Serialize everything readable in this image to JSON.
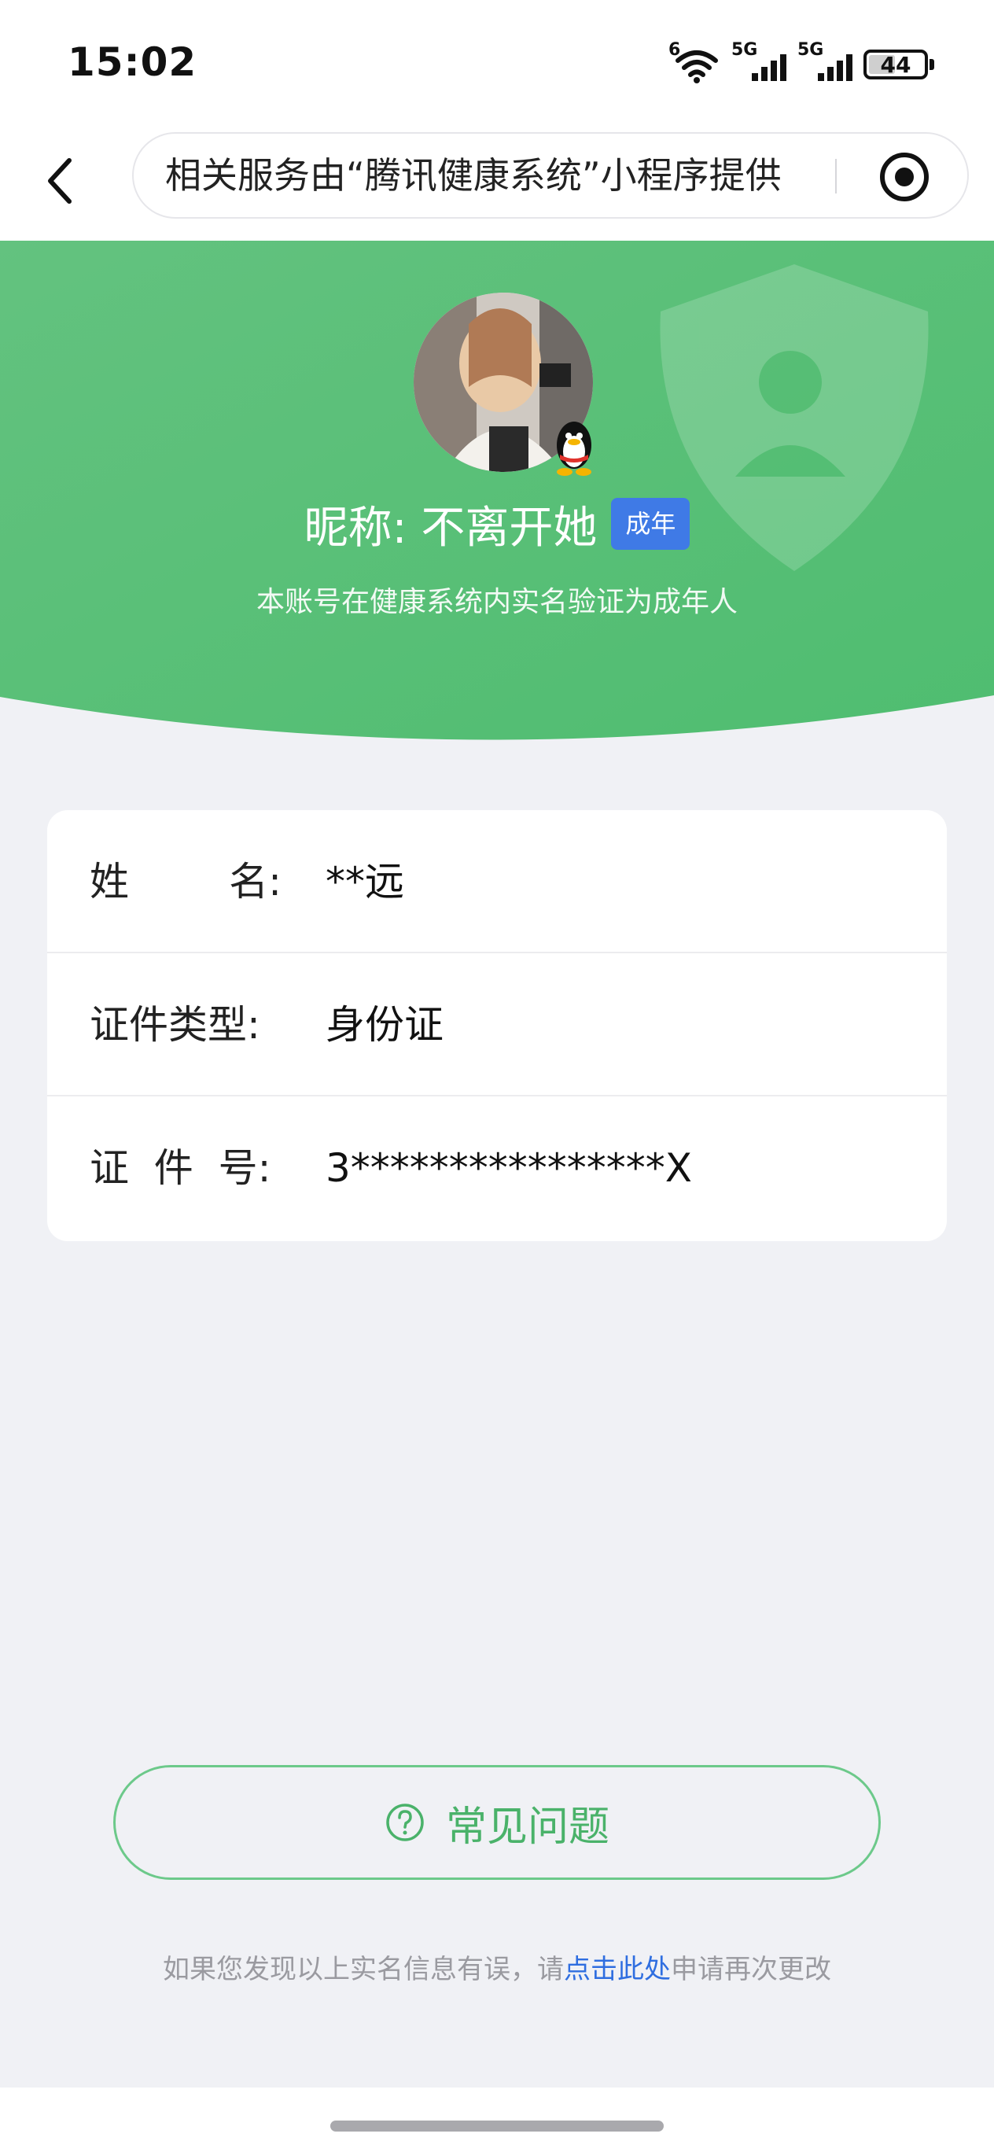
{
  "status_bar": {
    "time": "15:02",
    "wifi_label": "6",
    "sim1_label": "5G",
    "sim2_label": "5G",
    "battery_level": "44"
  },
  "nav": {
    "title": "相关服务由“腾讯健康系统”小程序提供",
    "back_icon": "chevron-left-icon",
    "record_icon": "record-circle-icon"
  },
  "hero": {
    "nickname": "昵称: 不离开她",
    "badge": "成年",
    "subtitle": "本账号在健康系统内实名验证为成年人",
    "bg_color": "#5ec37d"
  },
  "info": {
    "rows": [
      {
        "label": "姓        名:",
        "value": "**远"
      },
      {
        "label": "证件类型:",
        "value": "身份证"
      },
      {
        "label": "证  件  号:",
        "value": "3****************X"
      }
    ]
  },
  "faq": {
    "label": "常见问题",
    "icon": "question-circle-icon"
  },
  "footer": {
    "text_before": "如果您发现以上实名信息有误，请",
    "link_text": "点击此处",
    "text_after": "申请再次更改"
  },
  "colors": {
    "accent_green": "#4ab26a",
    "badge_blue": "#3f7ae6",
    "link_blue": "#2f6ee0"
  }
}
